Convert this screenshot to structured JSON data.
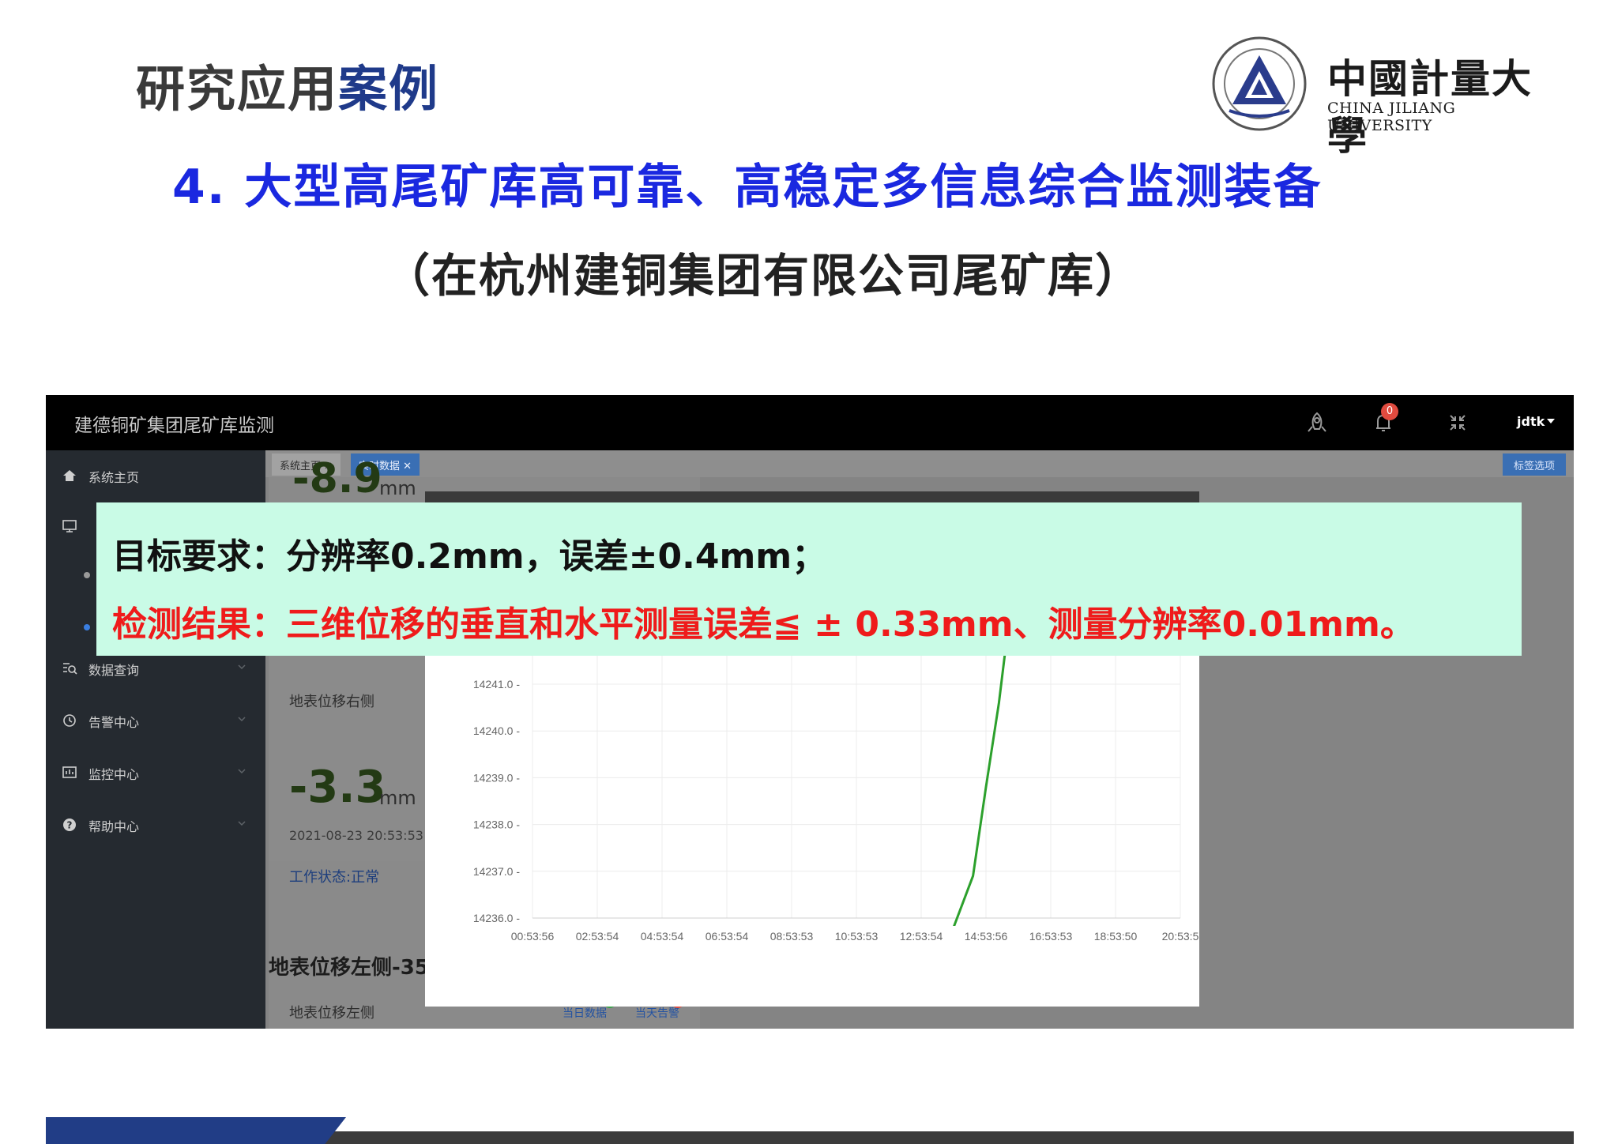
{
  "slide": {
    "heading_dark": "研究应用",
    "heading_blue": "案例",
    "title": "4. 大型高尾矿库高可靠、高稳定多信息综合监测装备",
    "subtitle": "（在杭州建铜集团有限公司尾矿库）",
    "logo": {
      "name_cn": "中國計量大學",
      "name_en": "CHINA JILIANG UNIVERSITY"
    }
  },
  "app": {
    "title": "建德铜矿集团尾矿库监测",
    "notification_count": "0",
    "user": "jdtk",
    "icons": [
      "rocket-icon",
      "bell-icon",
      "collapse-icon",
      "caret-down-icon"
    ]
  },
  "sidebar": {
    "items": [
      {
        "label": "系统主页",
        "icon": "home-icon"
      },
      {
        "label": "数据查询",
        "icon": "search-list-icon"
      },
      {
        "label": "告警中心",
        "icon": "alarm-icon"
      },
      {
        "label": "监控中心",
        "icon": "monitor-icon"
      },
      {
        "label": "帮助中心",
        "icon": "help-icon"
      }
    ]
  },
  "tabs": {
    "items": [
      {
        "label": "系统主页 ✕"
      },
      {
        "label": "实时数据 ✕"
      }
    ],
    "options_button": "标签选项"
  },
  "cards": {
    "top_value": "-8.9",
    "top_unit": "mm",
    "right_title": "地表位移右侧",
    "right_value": "-3.3",
    "right_unit": "mm",
    "right_time": "2021-08-23 20:53:53",
    "right_status": "工作状态:正常",
    "left_section": "地表位移左侧-35",
    "left_title": "地表位移左侧",
    "today_data": "当日数据",
    "today_alarm": "当天告警"
  },
  "overlay": {
    "line1": "目标要求：分辨率0.2mm，误差±0.4mm；",
    "line2": "检测结果：三维位移的垂直和水平测量误差≦ ± 0.33mm、测量分辨率0.01mm。"
  },
  "colors": {
    "brand_blue": "#1f3a8a",
    "title_blue": "#1a28e0",
    "result_red": "#ef1b1b",
    "overlay_bg": "#c9fbe6",
    "line_green": "#2ca02c",
    "alert_red": "#e04b3f",
    "tab_blue": "#3a6fb4"
  },
  "chart_data": {
    "type": "line",
    "x": [
      "00:53:56",
      "02:53:54",
      "04:53:54",
      "06:53:54",
      "08:53:53",
      "10:53:53",
      "12:53:54",
      "14:53:56",
      "16:53:53",
      "18:53:50",
      "20:53:5"
    ],
    "y_ticks": [
      "14236.0",
      "14237.0",
      "14238.0",
      "14239.0",
      "14240.0",
      "14241.0"
    ],
    "ylim": [
      14236.0,
      14241.0
    ],
    "series": [
      {
        "x_index": [
          0,
          1,
          2,
          3,
          4,
          5,
          6,
          6.5,
          6.8,
          7.0,
          7.2,
          7.35
        ],
        "values": [
          14235.8,
          14235.8,
          14235.8,
          14235.8,
          14235.8,
          14235.8,
          14235.8,
          14235.8,
          14236.9,
          14238.8,
          14240.6,
          14242.3
        ]
      }
    ],
    "grid": true
  }
}
